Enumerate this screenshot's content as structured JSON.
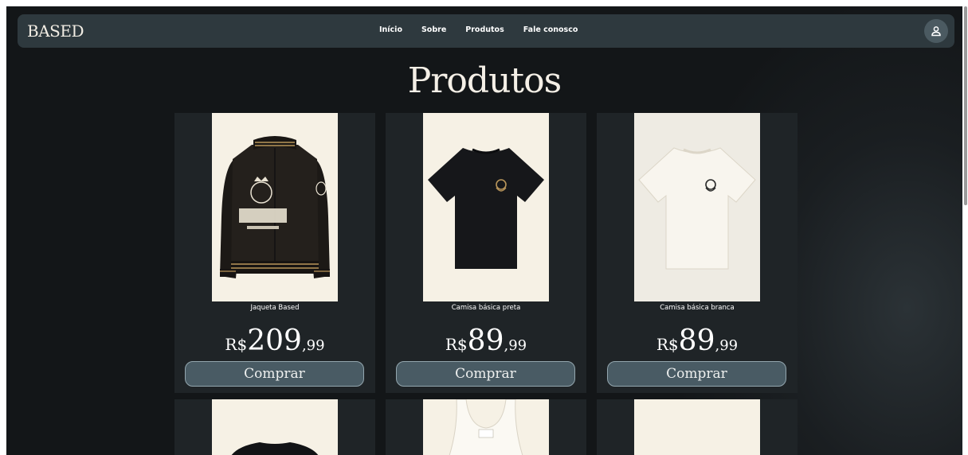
{
  "nav": {
    "brand": "BASED",
    "links": [
      "Início",
      "Sobre",
      "Produtos",
      "Fale conosco"
    ],
    "user_icon": "user-icon"
  },
  "page": {
    "title": "Produtos"
  },
  "products": [
    {
      "name": "Jaqueta Based",
      "currency": "R$",
      "price_int": "209",
      "price_dec": ",99",
      "button": "Comprar",
      "image": "leather-jacket-image"
    },
    {
      "name": "Camisa básica preta",
      "currency": "R$",
      "price_int": "89",
      "price_dec": ",99",
      "button": "Comprar",
      "image": "black-tshirt-image"
    },
    {
      "name": "Camisa básica branca",
      "currency": "R$",
      "price_int": "89",
      "price_dec": ",99",
      "button": "Comprar",
      "image": "white-tshirt-image"
    }
  ],
  "more_products": [
    {
      "image": "black-sweater-image"
    },
    {
      "image": "white-tank-top-image"
    },
    {
      "image": "blank-product-image"
    }
  ],
  "colors": {
    "background": "#1a1e21",
    "navbar": "#2e393e",
    "card": "#1f2427",
    "button": "#495b64",
    "image_bg": "#f6f1e5",
    "gold": "#b8955a"
  }
}
